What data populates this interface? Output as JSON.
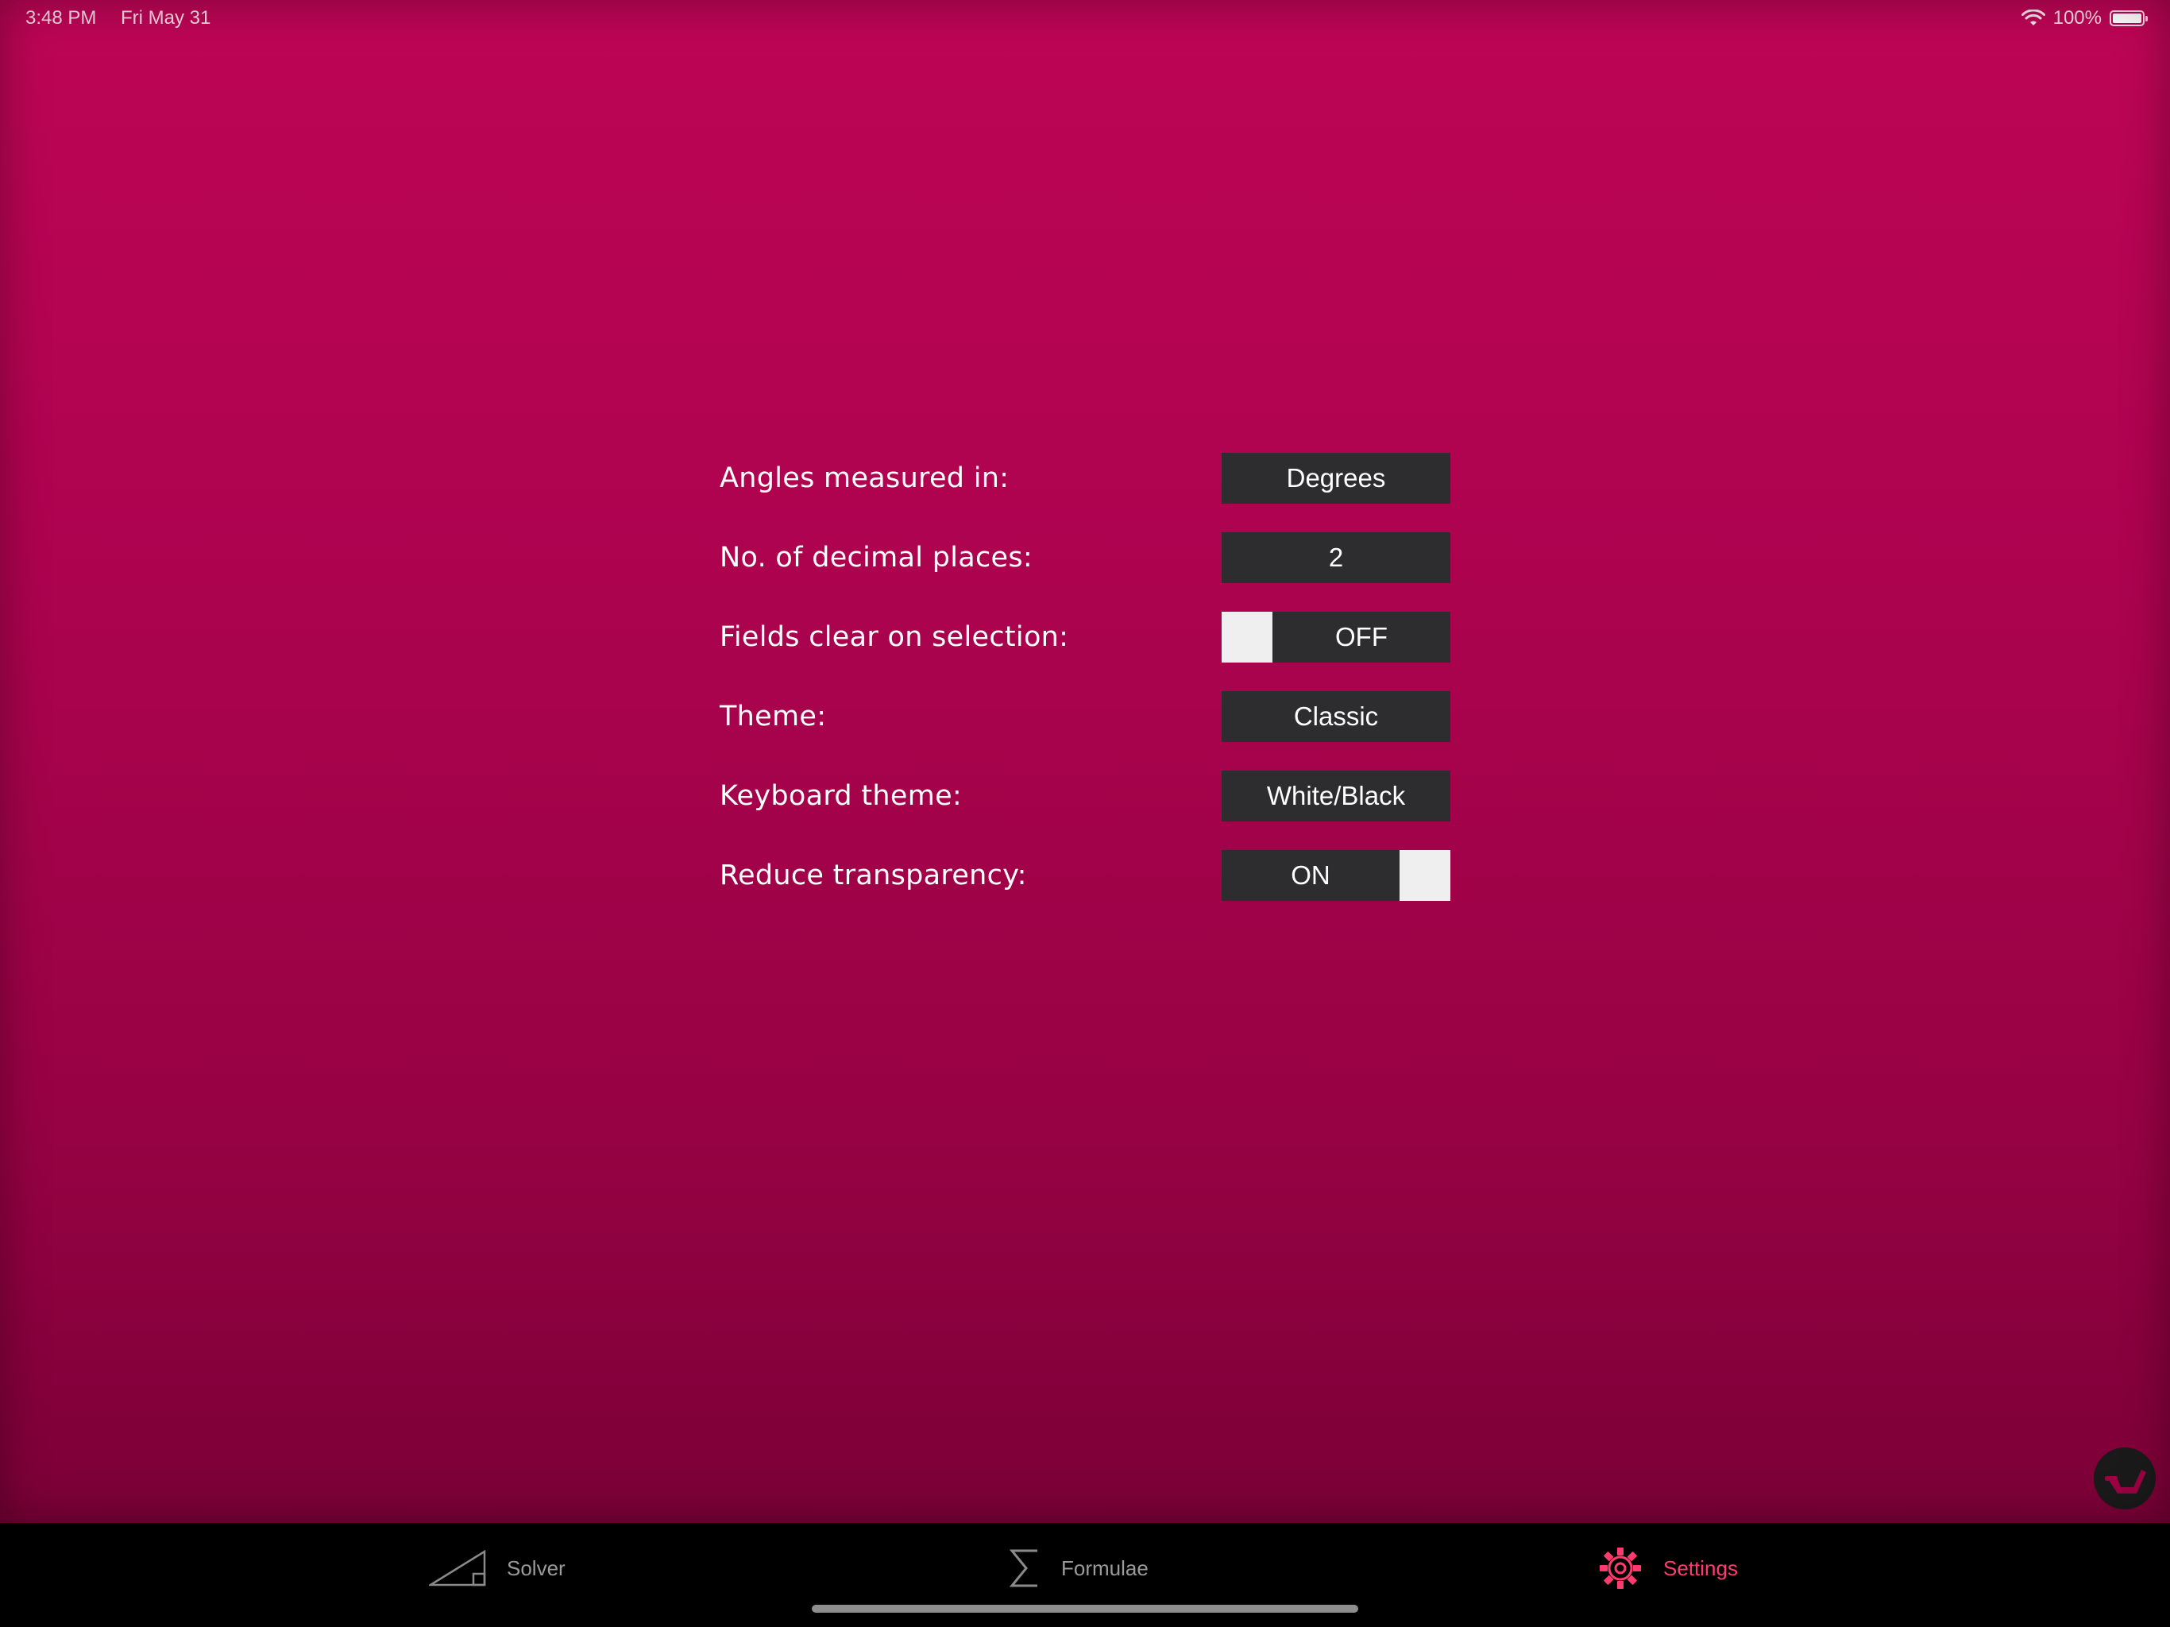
{
  "status_bar": {
    "time": "3:48 PM",
    "date": "Fri May 31",
    "battery": "100%",
    "icons": [
      "wifi-icon",
      "battery-icon"
    ]
  },
  "settings": {
    "angles": {
      "label": "Angles measured in:",
      "value": "Degrees"
    },
    "decimals": {
      "label": "No. of decimal places:",
      "value": "2"
    },
    "fields_clear": {
      "label": "Fields clear on selection:",
      "value": "OFF"
    },
    "theme": {
      "label": "Theme:",
      "value": "Classic"
    },
    "keyboard_theme": {
      "label": "Keyboard theme:",
      "value": "White/Black"
    },
    "reduce_transparency": {
      "label": "Reduce transparency:",
      "value": "ON"
    }
  },
  "fab": {
    "icon": "help-chair-icon"
  },
  "tab_bar": {
    "tabs": [
      {
        "label": "Solver",
        "icon": "triangle-icon",
        "active": false
      },
      {
        "label": "Formulae",
        "icon": "sigma-icon",
        "active": false
      },
      {
        "label": "Settings",
        "icon": "gear-icon",
        "active": true
      }
    ]
  },
  "colors": {
    "background_top": "#bd0555",
    "background_bottom": "#6e0032",
    "control_bg": "#2d2d2f",
    "toggle_knob": "#efefef",
    "tab_active": "#ff3a6e",
    "tab_inactive": "#9a9a9a",
    "tab_bar_bg": "#000000"
  }
}
